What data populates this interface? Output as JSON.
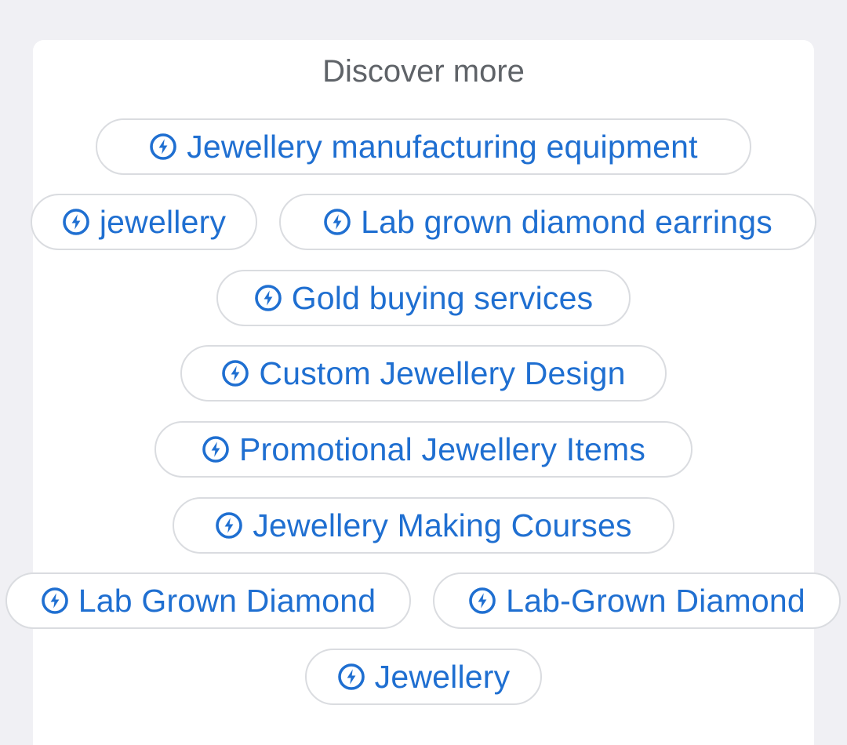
{
  "section": {
    "title": "Discover more"
  },
  "chips": [
    {
      "label": "Jewellery manufacturing equipment",
      "icon": "lightning-circle-icon"
    },
    {
      "label": "jewellery",
      "icon": "lightning-circle-icon"
    },
    {
      "label": "Lab grown diamond earrings",
      "icon": "lightning-circle-icon"
    },
    {
      "label": "Gold buying services",
      "icon": "lightning-circle-icon"
    },
    {
      "label": "Custom Jewellery Design",
      "icon": "lightning-circle-icon"
    },
    {
      "label": "Promotional Jewellery Items",
      "icon": "lightning-circle-icon"
    },
    {
      "label": "Jewellery Making Courses",
      "icon": "lightning-circle-icon"
    },
    {
      "label": "Lab Grown Diamond",
      "icon": "lightning-circle-icon"
    },
    {
      "label": "Lab-Grown Diamond",
      "icon": "lightning-circle-icon"
    },
    {
      "label": "Jewellery",
      "icon": "lightning-circle-icon"
    }
  ],
  "colors": {
    "accent": "#1f6fd1",
    "chip_border": "#dadce0",
    "title": "#5f6368",
    "background": "#f0f0f4"
  }
}
